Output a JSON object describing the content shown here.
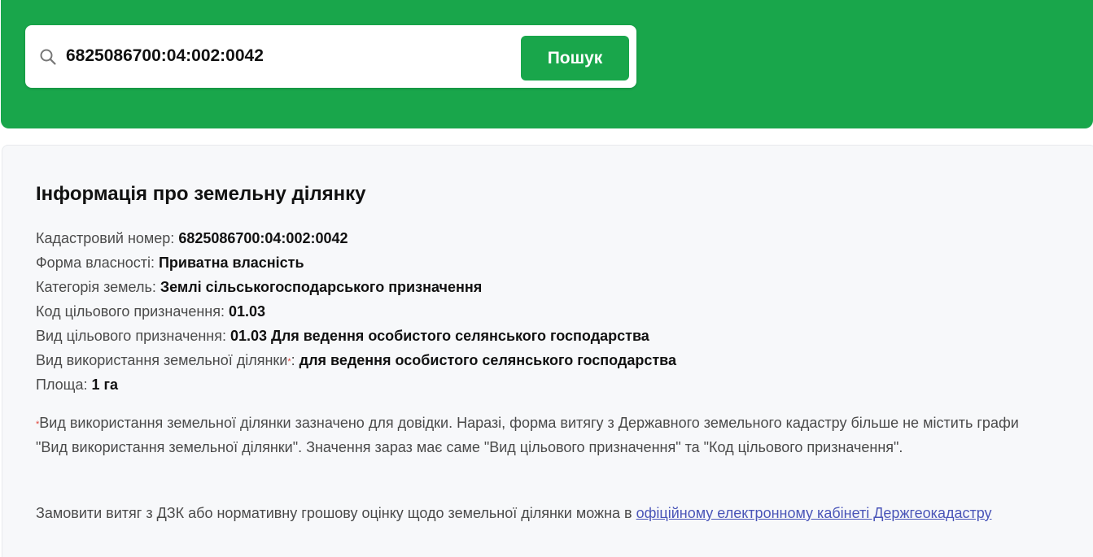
{
  "search": {
    "value": "6825086700:04:002:0042",
    "button_label": "Пошук",
    "icon": "search-icon"
  },
  "info": {
    "title": "Інформація про земельну ділянку",
    "rows": [
      {
        "label": "Кадастровий номер:",
        "value": "6825086700:04:002:0042"
      },
      {
        "label": "Форма власності:",
        "value": "Приватна власність"
      },
      {
        "label": "Категорія земель:",
        "value": "Землі сільськогосподарського призначення"
      },
      {
        "label": "Код цільового призначення:",
        "value": "01.03"
      },
      {
        "label": "Вид цільового призначення:",
        "value": "01.03 Для ведення особистого селянського господарства"
      },
      {
        "label": "Вид використання земельної ділянки",
        "marker": "*",
        "suffix": ":",
        "value": "для ведення особистого селянського господарства"
      },
      {
        "label": "Площа:",
        "value": "1 га"
      }
    ],
    "footnote_marker": "*",
    "footnote": "Вид використання земельної ділянки зазначено для довідки. Наразі, форма витягу з Державного земельного кадастру більше не містить графи \"Вид використання земельної ділянки\". Значення зараз має саме \"Вид цільового призначення\" та \"Код цільового призначення\".",
    "order_text": "Замовити витяг з ДЗК або нормативну грошову оцінку щодо земельної ділянки можна в",
    "order_link": "офіційному електронному кабінеті Держгеокадастру"
  },
  "colors": {
    "brand_green": "#19a64b",
    "link": "#4a55b8",
    "marker_red": "#e0453a"
  }
}
